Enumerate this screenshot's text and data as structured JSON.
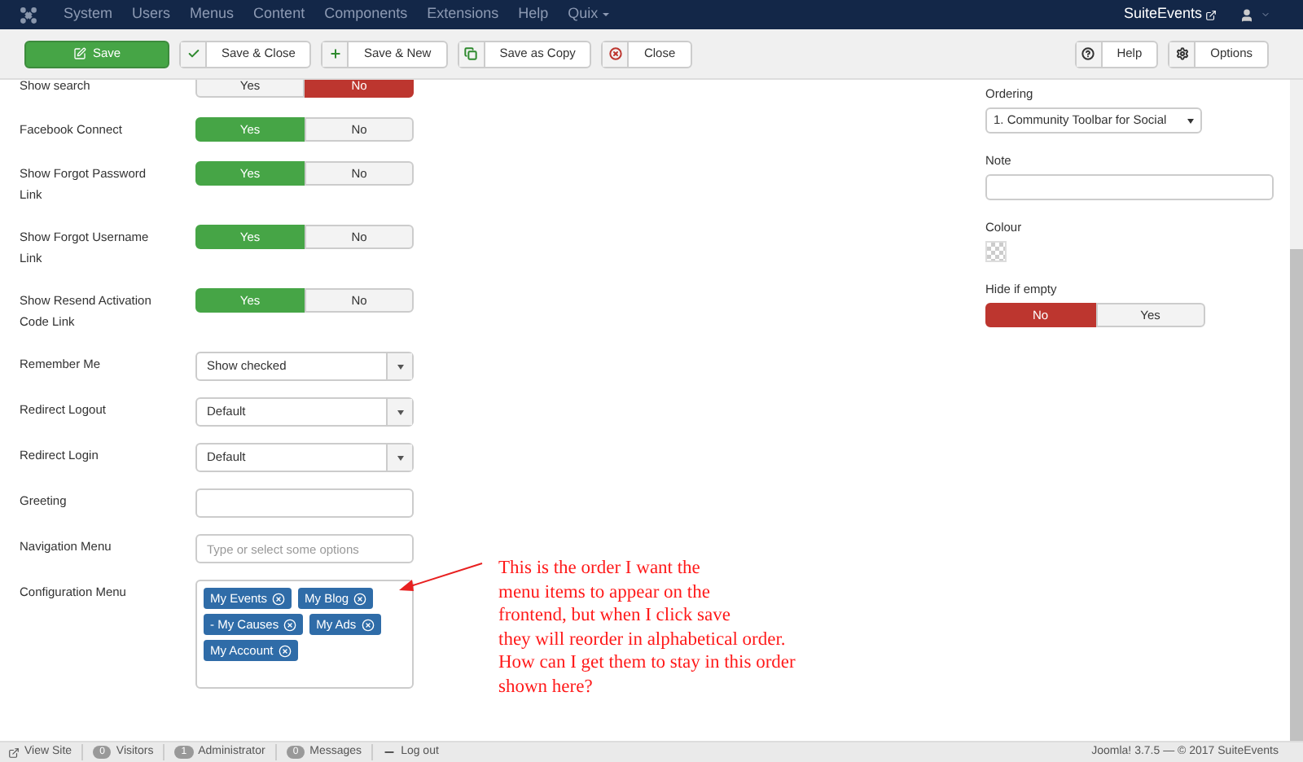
{
  "navbar": {
    "menu": [
      {
        "label": "System",
        "dropdown": false
      },
      {
        "label": "Users",
        "dropdown": false
      },
      {
        "label": "Menus",
        "dropdown": false
      },
      {
        "label": "Content",
        "dropdown": false
      },
      {
        "label": "Components",
        "dropdown": false
      },
      {
        "label": "Extensions",
        "dropdown": false
      },
      {
        "label": "Help",
        "dropdown": false
      },
      {
        "label": "Quix",
        "dropdown": true
      }
    ],
    "site_link": "SuiteEvents"
  },
  "toolbar": {
    "buttons": [
      {
        "label": "Save",
        "kind": "primary"
      },
      {
        "label": "Save & Close",
        "kind": "default"
      },
      {
        "label": "Save & New",
        "kind": "default"
      },
      {
        "label": "Save as Copy",
        "kind": "default"
      },
      {
        "label": "Close",
        "kind": "default"
      }
    ],
    "right_buttons": [
      {
        "label": "Help"
      },
      {
        "label": "Options"
      }
    ]
  },
  "form": {
    "fields": [
      {
        "label": "Show search",
        "kind": "toggle",
        "options": [
          {
            "label": "Yes",
            "selected": false
          },
          {
            "label": "No",
            "selected": true,
            "color": "#bd362f"
          }
        ]
      },
      {
        "label": "Facebook Connect",
        "kind": "toggle",
        "options": [
          {
            "label": "Yes",
            "selected": true,
            "color": "#46a546"
          },
          {
            "label": "No",
            "selected": false
          }
        ]
      },
      {
        "label": "Show Forgot Password Link",
        "kind": "toggle",
        "options": [
          {
            "label": "Yes",
            "selected": true,
            "color": "#46a546"
          },
          {
            "label": "No",
            "selected": false
          }
        ]
      },
      {
        "label": "Show Forgot Username Link",
        "kind": "toggle",
        "options": [
          {
            "label": "Yes",
            "selected": true,
            "color": "#46a546"
          },
          {
            "label": "No",
            "selected": false
          }
        ]
      },
      {
        "label": "Show Resend Activation Code Link",
        "kind": "toggle",
        "options": [
          {
            "label": "Yes",
            "selected": true,
            "color": "#46a546"
          },
          {
            "label": "No",
            "selected": false
          }
        ]
      },
      {
        "label": "Remember Me",
        "kind": "select",
        "value": "Show checked"
      },
      {
        "label": "Redirect Logout",
        "kind": "select",
        "value": "Default"
      },
      {
        "label": "Redirect Login",
        "kind": "select",
        "value": "Default"
      },
      {
        "label": "Greeting",
        "kind": "text"
      },
      {
        "label": "Navigation Menu",
        "kind": "text",
        "placeholder": "Type or select some options"
      },
      {
        "label": "Configuration Menu",
        "kind": "tags",
        "tags": [
          "My Events",
          "My Blog",
          "- My Causes",
          "My Ads",
          "My Account"
        ]
      }
    ]
  },
  "sidebar": {
    "ordering": {
      "label": "Ordering",
      "value": "1. Community Toolbar for Social"
    },
    "note": {
      "label": "Note"
    },
    "colour": {
      "label": "Colour"
    },
    "hide_if_empty": {
      "label": "Hide if empty",
      "options": [
        {
          "label": "No",
          "selected": true,
          "color": "#bd362f"
        },
        {
          "label": "Yes",
          "selected": false
        }
      ]
    }
  },
  "annotation": {
    "lines": [
      "This is the order I want the",
      "menu items to appear on the",
      "frontend, but when I click save",
      "they will reorder in alphabetical order.",
      "How can I get them to stay in this order",
      "shown here?"
    ]
  },
  "status_bar": {
    "items": [
      {
        "label": "View Site",
        "kind": "link"
      },
      {
        "label": "Visitors",
        "kind": "count",
        "count": "0"
      },
      {
        "label": "Administrator",
        "kind": "count",
        "count": "1"
      },
      {
        "label": "Messages",
        "kind": "count",
        "count": "0"
      },
      {
        "label": "Log out",
        "kind": "logout"
      }
    ],
    "version": "Joomla! 3.7.5 — © 2017 SuiteEvents"
  }
}
